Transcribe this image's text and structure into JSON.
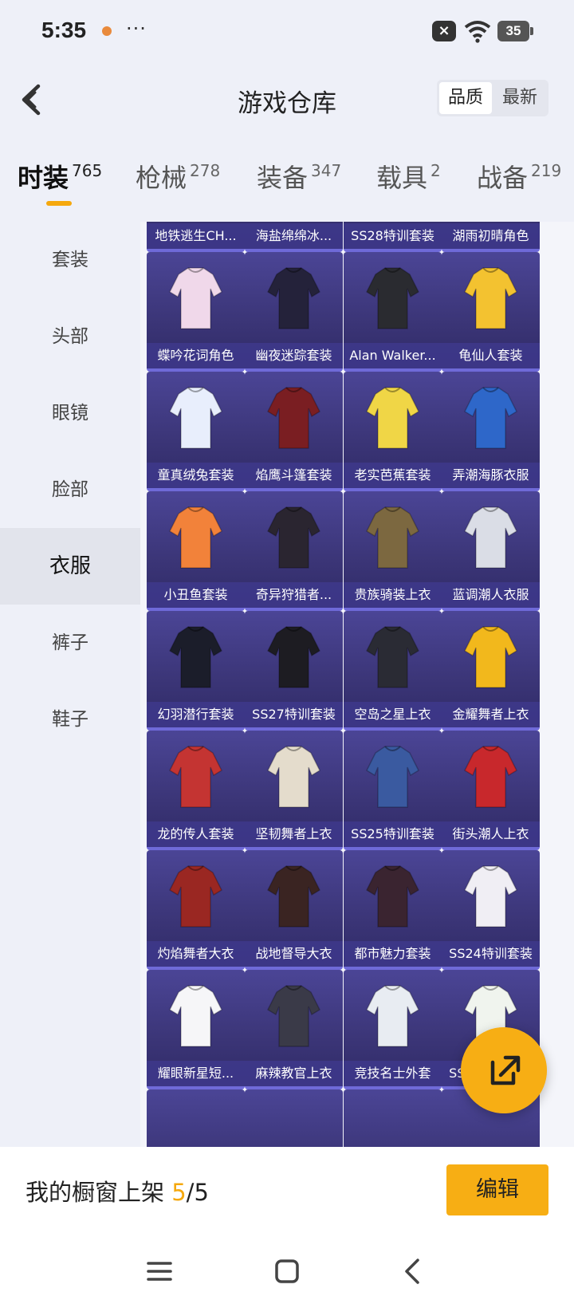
{
  "status_bar": {
    "time": "5:35",
    "more": "···",
    "battery": "35"
  },
  "header": {
    "title": "游戏仓库",
    "sort_options": [
      "品质",
      "最新"
    ],
    "sort_active": "品质"
  },
  "category_tabs": [
    {
      "label": "时装",
      "count": "765",
      "active": true
    },
    {
      "label": "枪械",
      "count": "278",
      "active": false
    },
    {
      "label": "装备",
      "count": "347",
      "active": false
    },
    {
      "label": "载具",
      "count": "2",
      "active": false
    },
    {
      "label": "战备",
      "count": "219",
      "active": false
    }
  ],
  "sidebar": {
    "items": [
      "套装",
      "头部",
      "眼镜",
      "脸部",
      "衣服",
      "裤子",
      "鞋子"
    ],
    "active": "衣服"
  },
  "items": [
    "地铁逃生CH...",
    "海盐绵绵冰...",
    "SS28特训套装",
    "湖雨初晴角色",
    "蝶吟花词角色",
    "幽夜迷踪套装",
    "Alan Walker...",
    "龟仙人套装",
    "童真绒兔套装",
    "焰鹰斗篷套装",
    "老实芭蕉套装",
    "弄潮海豚衣服",
    "小丑鱼套装",
    "奇异狩猎者...",
    "贵族骑装上衣",
    "蓝调潮人衣服",
    "幻羽潜行套装",
    "SS27特训套装",
    "空岛之星上衣",
    "金耀舞者上衣",
    "龙的传人套装",
    "坚韧舞者上衣",
    "SS25特训套装",
    "街头潮人上衣",
    "灼焰舞者大衣",
    "战地督导大衣",
    "都市魅力套装",
    "SS24特训套装",
    "耀眼新星短...",
    "麻辣教官上衣",
    "竞技名士外套",
    "SS21特训套装"
  ],
  "item_colors": [
    "#b0a9c4",
    "#cfd7ef",
    "#2e2c35",
    "#6b5d9a",
    "#f0d8ea",
    "#24223a",
    "#2a2b30",
    "#f3c230",
    "#e8eefc",
    "#7a1e22",
    "#f0d646",
    "#2e67c9",
    "#f2823a",
    "#2a2530",
    "#7c6840",
    "#dadde6",
    "#1b1d2a",
    "#1d1c22",
    "#2a2b34",
    "#f2b81c",
    "#c43432",
    "#e4dccc",
    "#3a5aa0",
    "#c8282c",
    "#9a2722",
    "#3a2422",
    "#3a2430",
    "#f0eef4",
    "#f6f6f8",
    "#3a3a48",
    "#e8ecf2",
    "#f0f4ee"
  ],
  "bottom": {
    "showcase_label": "我的橱窗上架 ",
    "showcase_current": "5",
    "showcase_total": "/5",
    "edit_label": "编辑"
  },
  "fab": {
    "icon": "share-icon"
  },
  "nav": [
    "menu-icon",
    "home-icon",
    "back-icon"
  ]
}
